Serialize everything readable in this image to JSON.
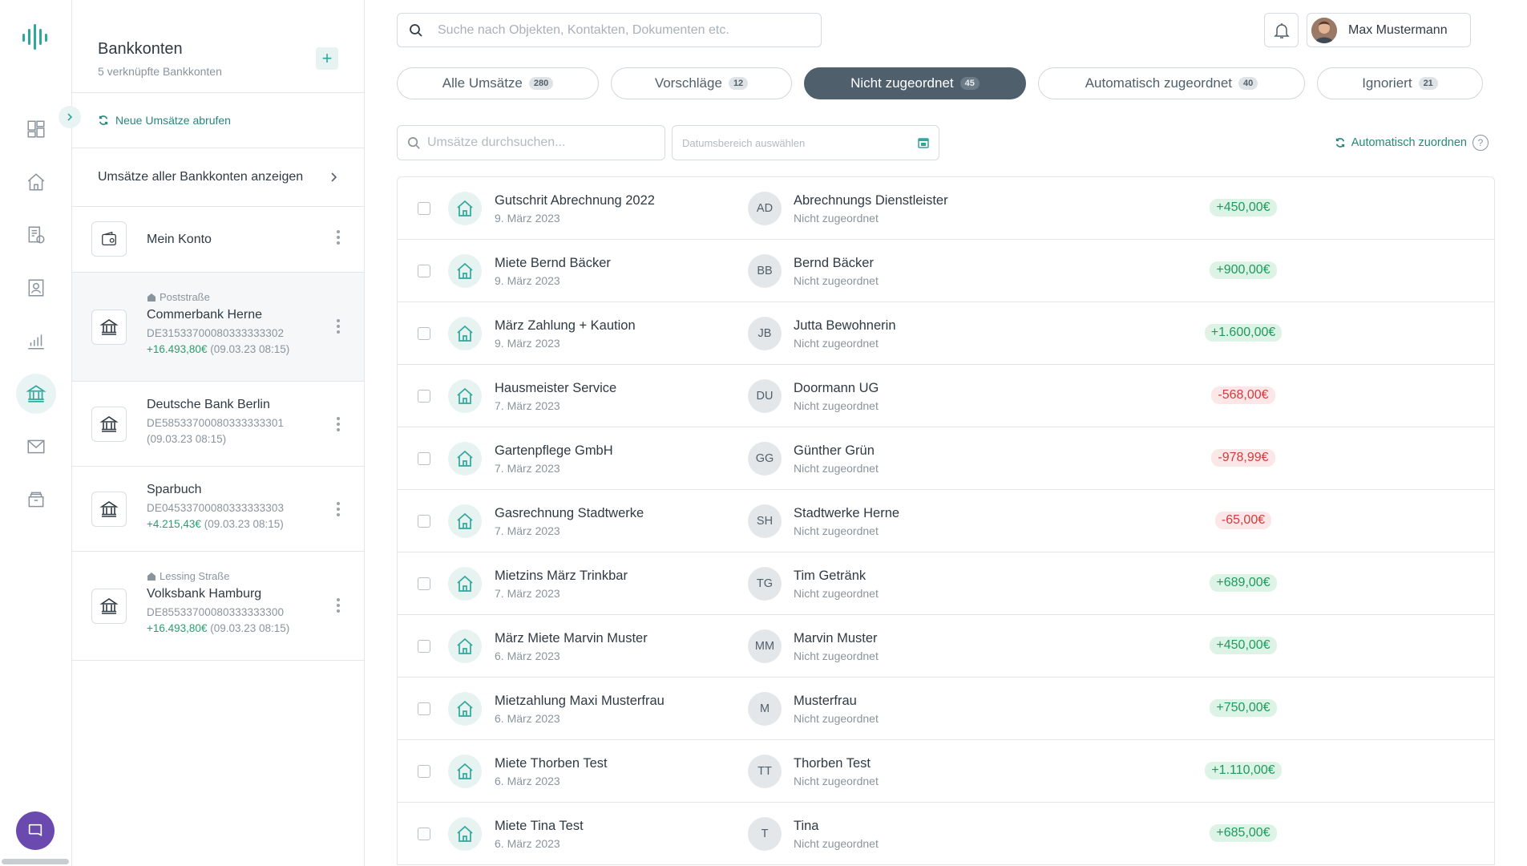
{
  "search": {
    "placeholder": "Suche nach Objekten, Kontakten, Dokumenten etc."
  },
  "user": {
    "name": "Max Mustermann"
  },
  "accounts": {
    "title": "Bankkonten",
    "subtitle": "5 verknüpfte Bankkonten",
    "add_icon": "plus-icon",
    "fetch_label": "Neue Umsätze abrufen",
    "all_label": "Umsätze aller Bankkonten anzeigen",
    "items": [
      {
        "tag": "",
        "name": "Mein Konto",
        "iban": "",
        "balance": "",
        "time": "",
        "icon": "wallet-icon"
      },
      {
        "tag": "Poststraße",
        "name": "Commerbank Herne",
        "iban": "DE31533700080333333302",
        "balance": "+16.493,80€",
        "time": "(09.03.23 08:15)",
        "icon": "bank-icon"
      },
      {
        "tag": "",
        "name": "Deutsche Bank Berlin",
        "iban": "DE58533700080333333301",
        "balance": "",
        "time": "(09.03.23 08:15)",
        "icon": "bank-icon"
      },
      {
        "tag": "",
        "name": "Sparbuch",
        "iban": "DE04533700080333333303",
        "balance": "+4.215,43€",
        "time": "(09.03.23 08:15)",
        "icon": "bank-icon"
      },
      {
        "tag": "Lessing Straße",
        "name": "Volksbank Hamburg",
        "iban": "DE85533700080333333300",
        "balance": "+16.493,80€",
        "time": "(09.03.23 08:15)",
        "icon": "bank-icon"
      }
    ]
  },
  "tabs": [
    {
      "label": "Alle Umsätze",
      "count": "280"
    },
    {
      "label": "Vorschläge",
      "count": "12"
    },
    {
      "label": "Nicht zugeordnet",
      "count": "45"
    },
    {
      "label": "Automatisch zugeordnet",
      "count": "40"
    },
    {
      "label": "Ignoriert",
      "count": "21"
    }
  ],
  "filters": {
    "search_placeholder": "Umsätze durchsuchen...",
    "date_placeholder": "Datumsbereich auswählen",
    "auto_assign_label": "Automatisch zuordnen",
    "help": "?"
  },
  "transactions": [
    {
      "title": "Gutschrit Abrechnung 2022",
      "date": "9. März 2023",
      "initials": "AD",
      "party": "Abrechnungs Dienstleister",
      "status": "Nicht zugeordnet",
      "amount": "+450,00€",
      "sign": "pos"
    },
    {
      "title": "Miete Bernd Bäcker",
      "date": "9. März 2023",
      "initials": "BB",
      "party": "Bernd Bäcker",
      "status": "Nicht zugeordnet",
      "amount": "+900,00€",
      "sign": "pos"
    },
    {
      "title": "März Zahlung + Kaution",
      "date": "9. März 2023",
      "initials": "JB",
      "party": "Jutta Bewohnerin",
      "status": "Nicht zugeordnet",
      "amount": "+1.600,00€",
      "sign": "pos"
    },
    {
      "title": "Hausmeister Service",
      "date": "7. März 2023",
      "initials": "DU",
      "party": "Doormann UG",
      "status": "Nicht zugeordnet",
      "amount": "-568,00€",
      "sign": "neg"
    },
    {
      "title": "Gartenpflege GmbH",
      "date": "7. März 2023",
      "initials": "GG",
      "party": "Günther Grün",
      "status": "Nicht zugeordnet",
      "amount": "-978,99€",
      "sign": "neg"
    },
    {
      "title": "Gasrechnung Stadtwerke",
      "date": "7. März 2023",
      "initials": "SH",
      "party": "Stadtwerke Herne",
      "status": "Nicht zugeordnet",
      "amount": "-65,00€",
      "sign": "neg"
    },
    {
      "title": "Mietzins März Trinkbar",
      "date": "7. März 2023",
      "initials": "TG",
      "party": "Tim Getränk",
      "status": "Nicht zugeordnet",
      "amount": "+689,00€",
      "sign": "pos"
    },
    {
      "title": "März Miete Marvin Muster",
      "date": "6. März 2023",
      "initials": "MM",
      "party": "Marvin Muster",
      "status": "Nicht zugeordnet",
      "amount": "+450,00€",
      "sign": "pos"
    },
    {
      "title": "Mietzahlung Maxi Musterfrau",
      "date": "6. März 2023",
      "initials": "M",
      "party": "Musterfrau",
      "status": "Nicht zugeordnet",
      "amount": "+750,00€",
      "sign": "pos"
    },
    {
      "title": "Miete Thorben Test",
      "date": "6. März 2023",
      "initials": "TT",
      "party": "Thorben Test",
      "status": "Nicht zugeordnet",
      "amount": "+1.110,00€",
      "sign": "pos"
    },
    {
      "title": "Miete Tina Test",
      "date": "6. März 2023",
      "initials": "T",
      "party": "Tina",
      "status": "Nicht zugeordnet",
      "amount": "+685,00€",
      "sign": "pos"
    }
  ],
  "colors": {
    "accent": "#2fa89c",
    "positive": "#1f9a5e",
    "negative": "#d23c3c",
    "active_tab": "#4f5f6c"
  },
  "rail_icons": [
    "dashboard-icon",
    "home-icon",
    "documents-icon",
    "contacts-icon",
    "chart-icon",
    "bank-icon",
    "mail-icon",
    "archive-icon"
  ]
}
